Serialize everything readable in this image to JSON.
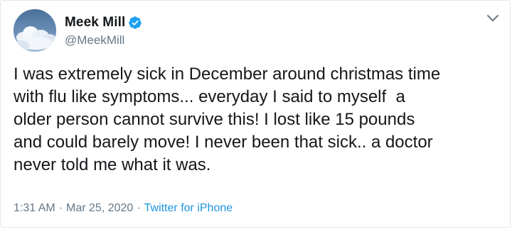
{
  "author": {
    "display_name": "Meek Mill",
    "handle": "@MeekMill",
    "verified": true,
    "avatar_icon": "cloud-sky-avatar"
  },
  "tweet": {
    "text": "I was extremely sick in December around christmas time\nwith flu like symptoms... everyday I said to myself  a\nolder person cannot survive this! I lost like 15 pounds\nand could barely move! I never been that sick.. a doctor\nnever told me what it was."
  },
  "meta": {
    "time": "1:31 AM",
    "separator": "·",
    "date": "Mar 25, 2020",
    "source": "Twitter for iPhone"
  },
  "colors": {
    "text": "#14171a",
    "secondary": "#657786",
    "link": "#1b95e0",
    "border": "#e1e8ed"
  }
}
